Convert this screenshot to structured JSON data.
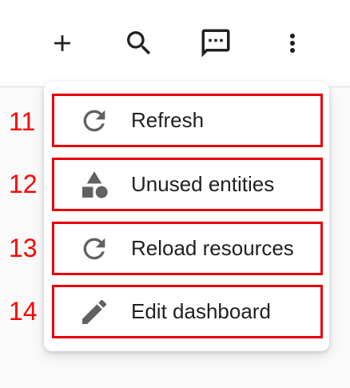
{
  "toolbar": {
    "buttons": [
      {
        "icon": "plus-icon"
      },
      {
        "icon": "search-icon"
      },
      {
        "icon": "chat-icon"
      },
      {
        "icon": "more-vertical-icon"
      }
    ]
  },
  "menu": {
    "items": [
      {
        "number": "11",
        "label": "Refresh",
        "icon": "refresh-icon"
      },
      {
        "number": "12",
        "label": "Unused entities",
        "icon": "shapes-icon"
      },
      {
        "number": "13",
        "label": "Reload resources",
        "icon": "refresh-icon"
      },
      {
        "number": "14",
        "label": "Edit dashboard",
        "icon": "pencil-icon"
      }
    ]
  },
  "colors": {
    "icon": "#616161",
    "text": "#212121",
    "annotation": "#ff0000",
    "highlight_border": "#e8000b"
  }
}
